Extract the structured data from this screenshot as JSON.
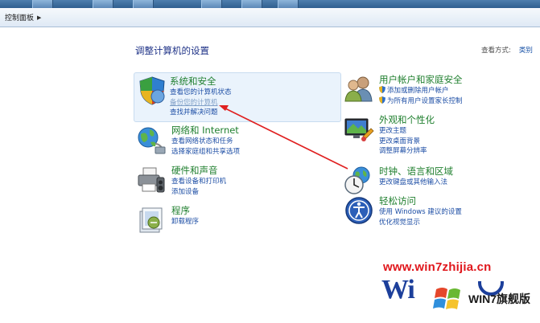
{
  "address_bar": {
    "crumb": "控制面板"
  },
  "header": {
    "title": "调整计算机的设置",
    "view_by_label": "查看方式:",
    "view_by_value": "类别"
  },
  "categories": [
    {
      "title": "系统和安全",
      "links": [
        "查看您的计算机状态",
        "备份您的计算机",
        "查找并解决问题"
      ]
    },
    {
      "title": "网络和 Internet",
      "links": [
        "查看网络状态和任务",
        "选择家庭组和共享选项"
      ]
    },
    {
      "title": "硬件和声音",
      "links": [
        "查看设备和打印机",
        "添加设备"
      ]
    },
    {
      "title": "程序",
      "links": [
        "卸载程序"
      ]
    },
    {
      "title": "用户帐户和家庭安全",
      "links": [
        "添加或删除用户帐户",
        "为所有用户设置家长控制"
      ]
    },
    {
      "title": "外观和个性化",
      "links": [
        "更改主题",
        "更改桌面背景",
        "调整屏幕分辨率"
      ]
    },
    {
      "title": "时钟、语言和区域",
      "links": [
        "更改键盘或其他输入法"
      ]
    },
    {
      "title": "轻松访问",
      "links": [
        "使用 Windows 建议的设置",
        "优化视觉显示"
      ]
    }
  ],
  "watermark": {
    "url": "www.win7zhijia.cn",
    "logo": "Wi",
    "badge": "WIN7旗舰版"
  },
  "colors": {
    "category_title": "#1f7f2e",
    "link": "#1d4ea5",
    "page_title": "#1e3287",
    "annotation_arrow": "#e02020"
  }
}
